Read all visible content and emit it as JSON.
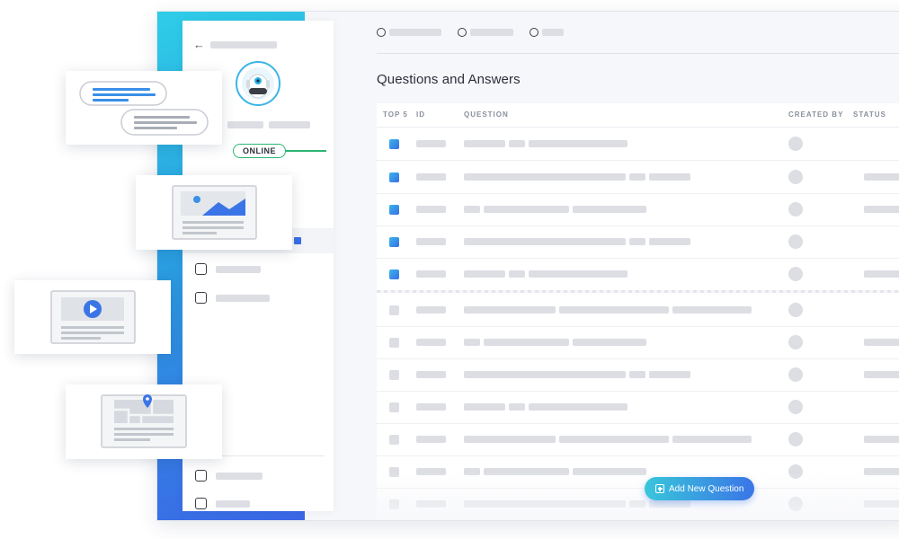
{
  "page_title": "Questions and Answers",
  "status_badge": "ONLINE",
  "table": {
    "headers": {
      "top5": "TOP 5",
      "id": "ID",
      "question": "QUESTION",
      "created_by": "CREATED BY",
      "status": "STATUS"
    }
  },
  "add_button_label": "Add New Question",
  "colors": {
    "accent_start": "#2fcde8",
    "accent_end": "#3b66e6",
    "online": "#2bb673"
  },
  "icons": [
    "back-arrow-icon",
    "robot-avatar-icon",
    "chat-bubbles-icon",
    "image-icon",
    "video-play-icon",
    "map-pin-icon",
    "plus-icon"
  ]
}
